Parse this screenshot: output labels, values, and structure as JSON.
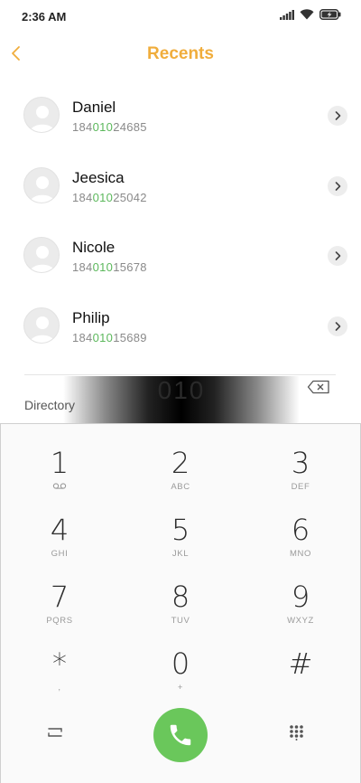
{
  "status_bar": {
    "time": "2:36 AM",
    "icons": [
      "signal-icon",
      "wifi-icon",
      "battery-charging-icon"
    ]
  },
  "header": {
    "title": "Recents",
    "back_icon": "chevron-left-icon"
  },
  "recents": [
    {
      "name": "Daniel",
      "number_prefix": "184",
      "number_match": "010",
      "number_suffix": "24685"
    },
    {
      "name": "Jeesica",
      "number_prefix": "184",
      "number_match": "010",
      "number_suffix": "25042"
    },
    {
      "name": "Nicole",
      "number_prefix": "184",
      "number_match": "010",
      "number_suffix": "15678"
    },
    {
      "name": "Philip",
      "number_prefix": "184",
      "number_match": "010",
      "number_suffix": "15689"
    }
  ],
  "input": {
    "digits": "010",
    "directory_label": "Directory"
  },
  "keypad": {
    "keys": [
      {
        "digit": "1",
        "letters": "",
        "sub_icon": "voicemail-icon"
      },
      {
        "digit": "2",
        "letters": "ABC"
      },
      {
        "digit": "3",
        "letters": "DEF"
      },
      {
        "digit": "4",
        "letters": "GHI"
      },
      {
        "digit": "5",
        "letters": "JKL"
      },
      {
        "digit": "6",
        "letters": "MNO"
      },
      {
        "digit": "7",
        "letters": "PQRS"
      },
      {
        "digit": "8",
        "letters": "TUV"
      },
      {
        "digit": "9",
        "letters": "WXYZ"
      },
      {
        "digit": "*",
        "letters": ","
      },
      {
        "digit": "0",
        "letters": "+"
      },
      {
        "digit": "#",
        "letters": ""
      }
    ]
  },
  "colors": {
    "accent": "#f0ad3c",
    "match_highlight": "#5cb85c",
    "call_button": "#6ac75b"
  }
}
